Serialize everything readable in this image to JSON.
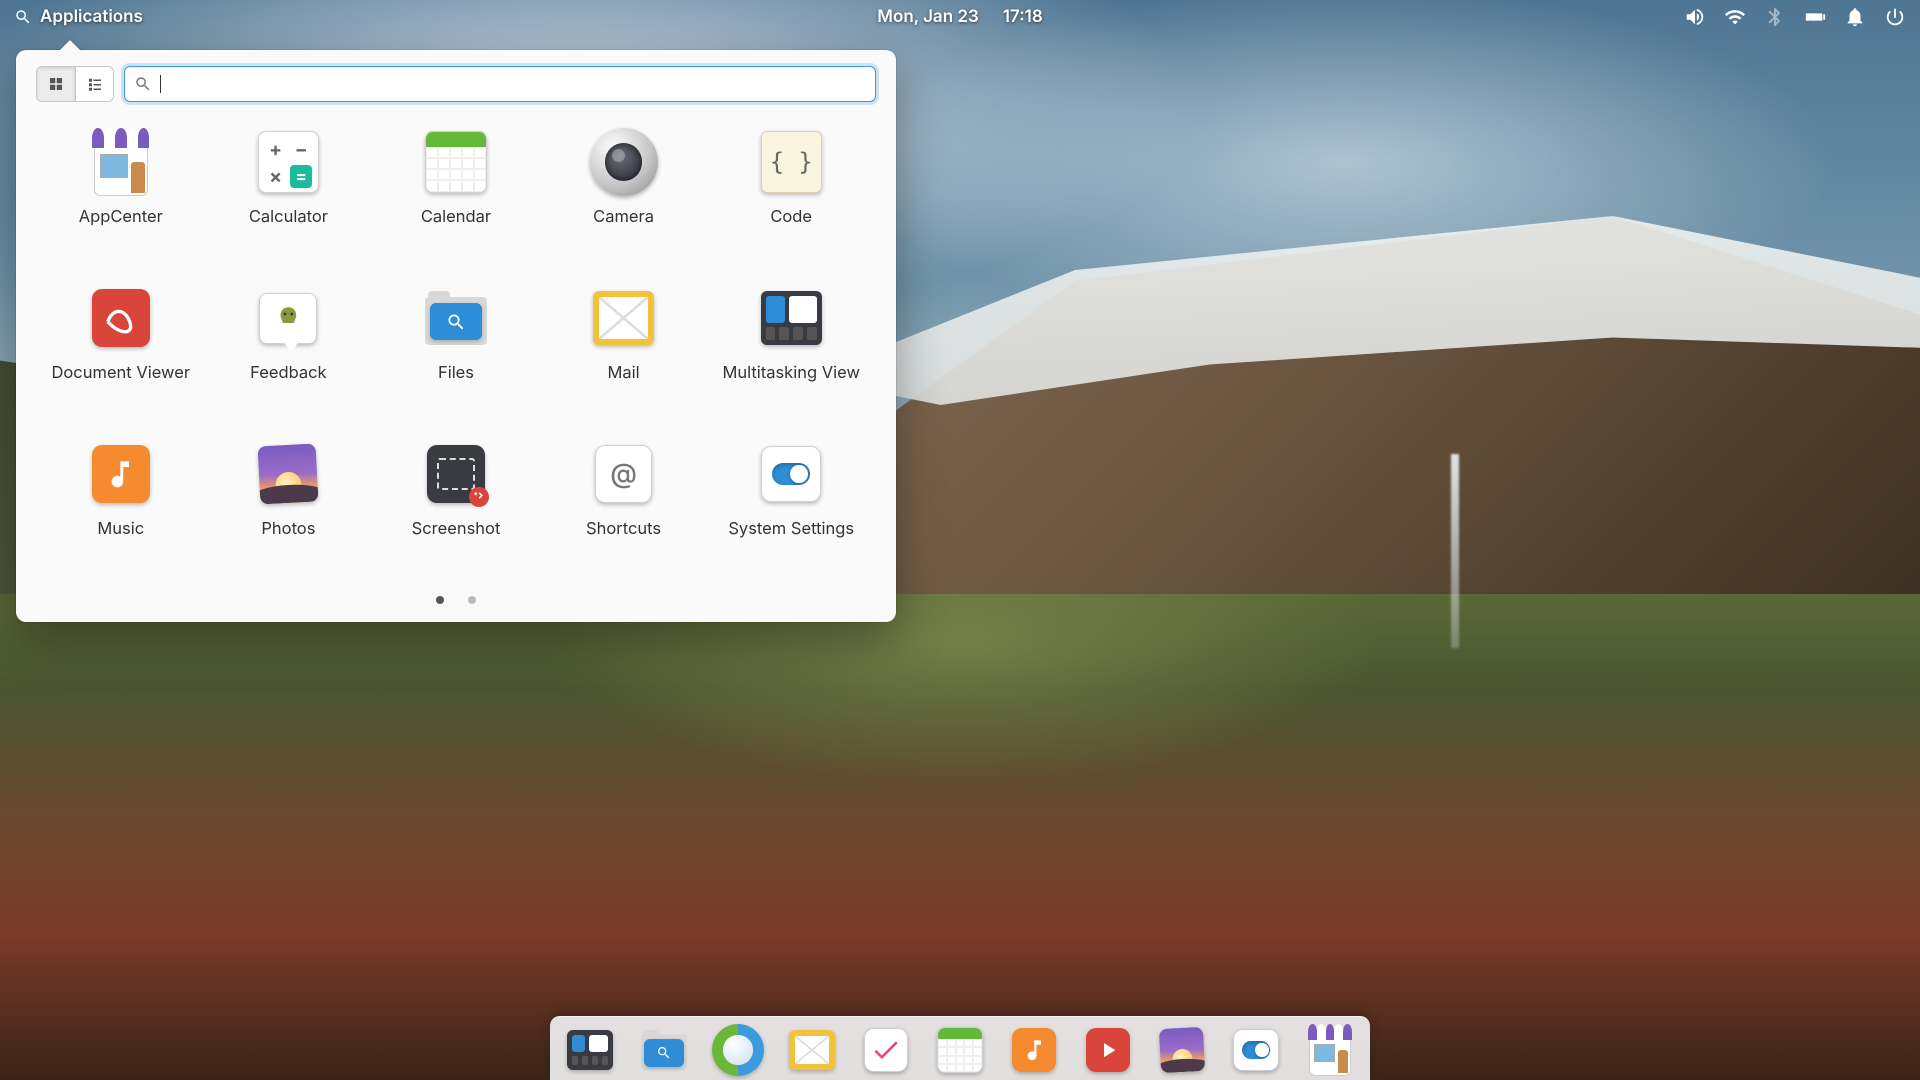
{
  "panel": {
    "applications_label": "Applications",
    "date": "Mon, Jan 23",
    "time": "17:18"
  },
  "launcher": {
    "search_placeholder": "",
    "apps": [
      {
        "id": "appcenter",
        "label": "AppCenter"
      },
      {
        "id": "calculator",
        "label": "Calculator"
      },
      {
        "id": "calendar",
        "label": "Calendar"
      },
      {
        "id": "camera",
        "label": "Camera"
      },
      {
        "id": "code",
        "label": "Code"
      },
      {
        "id": "document-viewer",
        "label": "Document Viewer"
      },
      {
        "id": "feedback",
        "label": "Feedback"
      },
      {
        "id": "files",
        "label": "Files"
      },
      {
        "id": "mail",
        "label": "Mail"
      },
      {
        "id": "multitasking-view",
        "label": "Multitasking View"
      },
      {
        "id": "music",
        "label": "Music"
      },
      {
        "id": "photos",
        "label": "Photos"
      },
      {
        "id": "screenshot",
        "label": "Screenshot"
      },
      {
        "id": "shortcuts",
        "label": "Shortcuts"
      },
      {
        "id": "system-settings",
        "label": "System Settings"
      }
    ],
    "pages": 2,
    "active_page": 0
  },
  "dock": {
    "items": [
      "multitasking-view",
      "files",
      "web",
      "mail",
      "tasks",
      "calendar",
      "music",
      "videos",
      "photos",
      "system-settings",
      "appcenter"
    ]
  },
  "colors": {
    "accent": "#3b9bdc",
    "orange": "#f58b2e",
    "green": "#63b83a",
    "red": "#d9453a",
    "blue": "#2e8dd6",
    "purple": "#7a5cc0",
    "yellow": "#f2c23a"
  }
}
